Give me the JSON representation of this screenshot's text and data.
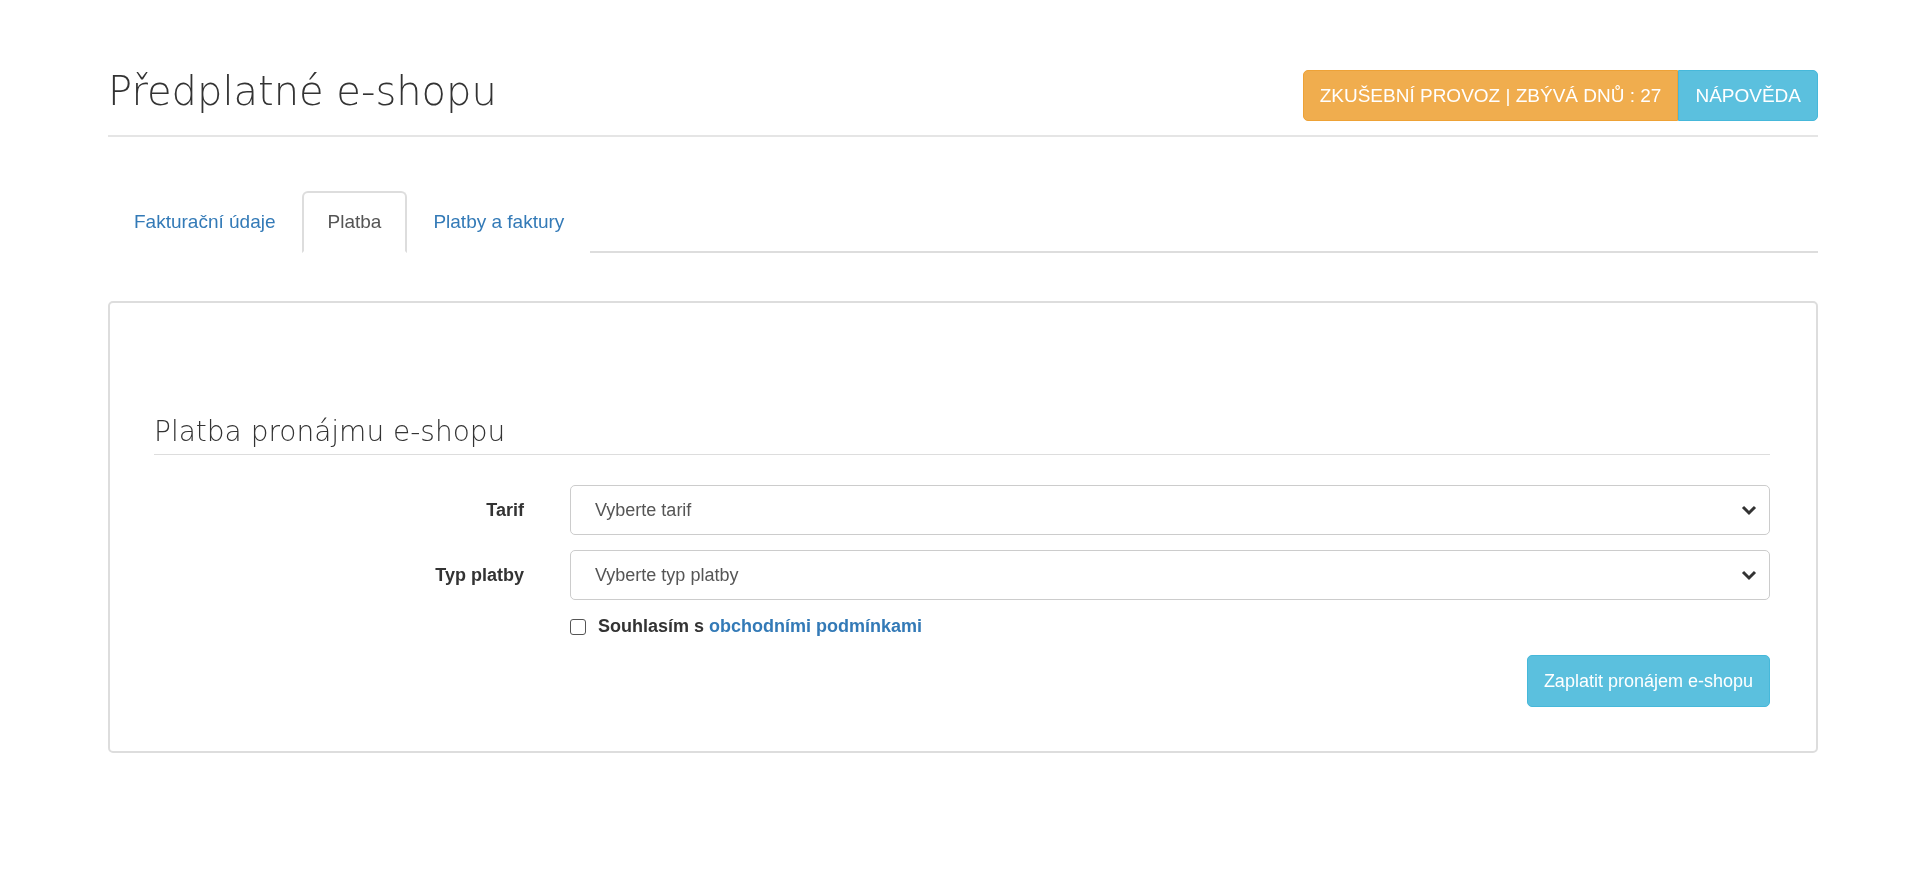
{
  "page": {
    "title": "Předplatné e-shopu"
  },
  "header_buttons": [
    {
      "kind": "warning",
      "label": "ZKUŠEBNÍ PROVOZ | ZBÝVÁ DNŮ : 27"
    },
    {
      "kind": "info",
      "label": "NÁPOVĚDA"
    }
  ],
  "tabs": [
    {
      "label": "Fakturační údaje",
      "selected": false
    },
    {
      "label": "Platba",
      "selected": true
    },
    {
      "label": "Platby a faktury",
      "selected": false
    }
  ],
  "section": {
    "title": "Platba pronájmu e-shopu",
    "fields": [
      {
        "label": "Tarif",
        "placeholder": "Vyberte tarif"
      },
      {
        "label": "Typ platby",
        "placeholder": "Vyberte typ platby"
      }
    ],
    "agreement": {
      "checked": false,
      "text": "Souhlasím s",
      "link": "obchodními podmínkami"
    },
    "submit": "Zaplatit pronájem e-shopu"
  }
}
